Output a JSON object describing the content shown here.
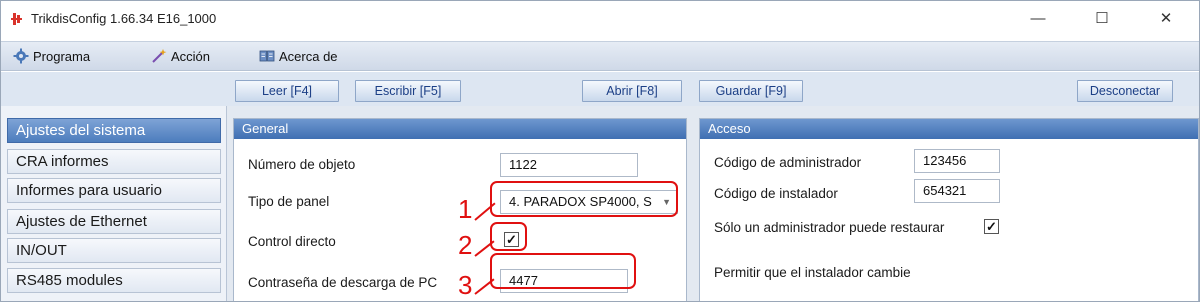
{
  "window": {
    "title": "TrikdisConfig 1.66.34   E16_1000",
    "controls": {
      "minimize": "—",
      "maximize": "☐",
      "close": "✕"
    }
  },
  "menu": {
    "items": [
      {
        "label": "Programa",
        "icon": "gear-icon"
      },
      {
        "label": "Acción",
        "icon": "wand-icon"
      },
      {
        "label": "Acerca de",
        "icon": "book-icon"
      }
    ]
  },
  "toolbar": {
    "read": "Leer [F4]",
    "write": "Escribir [F5]",
    "open": "Abrir [F8]",
    "save": "Guardar [F9]",
    "disconnect": "Desconectar"
  },
  "sidebar": {
    "items": [
      {
        "label": "Ajustes del sistema",
        "active": true
      },
      {
        "label": "CRA informes",
        "active": false
      },
      {
        "label": "Informes para usuario",
        "active": false
      },
      {
        "label": "Ajustes de Ethernet",
        "active": false
      },
      {
        "label": "IN/OUT",
        "active": false
      },
      {
        "label": "RS485 modules",
        "active": false
      }
    ]
  },
  "general": {
    "title": "General",
    "object_number_label": "Número de objeto",
    "object_number_value": "1122",
    "panel_type_label": "Tipo de panel",
    "panel_type_value": "4. PARADOX SP4000, S",
    "direct_control_label": "Control directo",
    "direct_control_checked": "✓",
    "pc_password_label": "Contraseña de descarga de PC",
    "pc_password_value": "4477"
  },
  "access": {
    "title": "Acceso",
    "admin_code_label": "Código de administrador",
    "admin_code_value": "123456",
    "installer_code_label": "Código de instalador",
    "installer_code_value": "654321",
    "only_admin_restore_label": "Sólo un administrador puede restaurar",
    "only_admin_restore_checked": "✓",
    "allow_installer_label": "Permitir que el instalador cambie"
  },
  "annotations": {
    "n1": "1",
    "n2": "2",
    "n3": "3"
  },
  "colors": {
    "accent": "#4d7dbd",
    "annotation": "#e01010",
    "link_text": "#1c3f86"
  }
}
